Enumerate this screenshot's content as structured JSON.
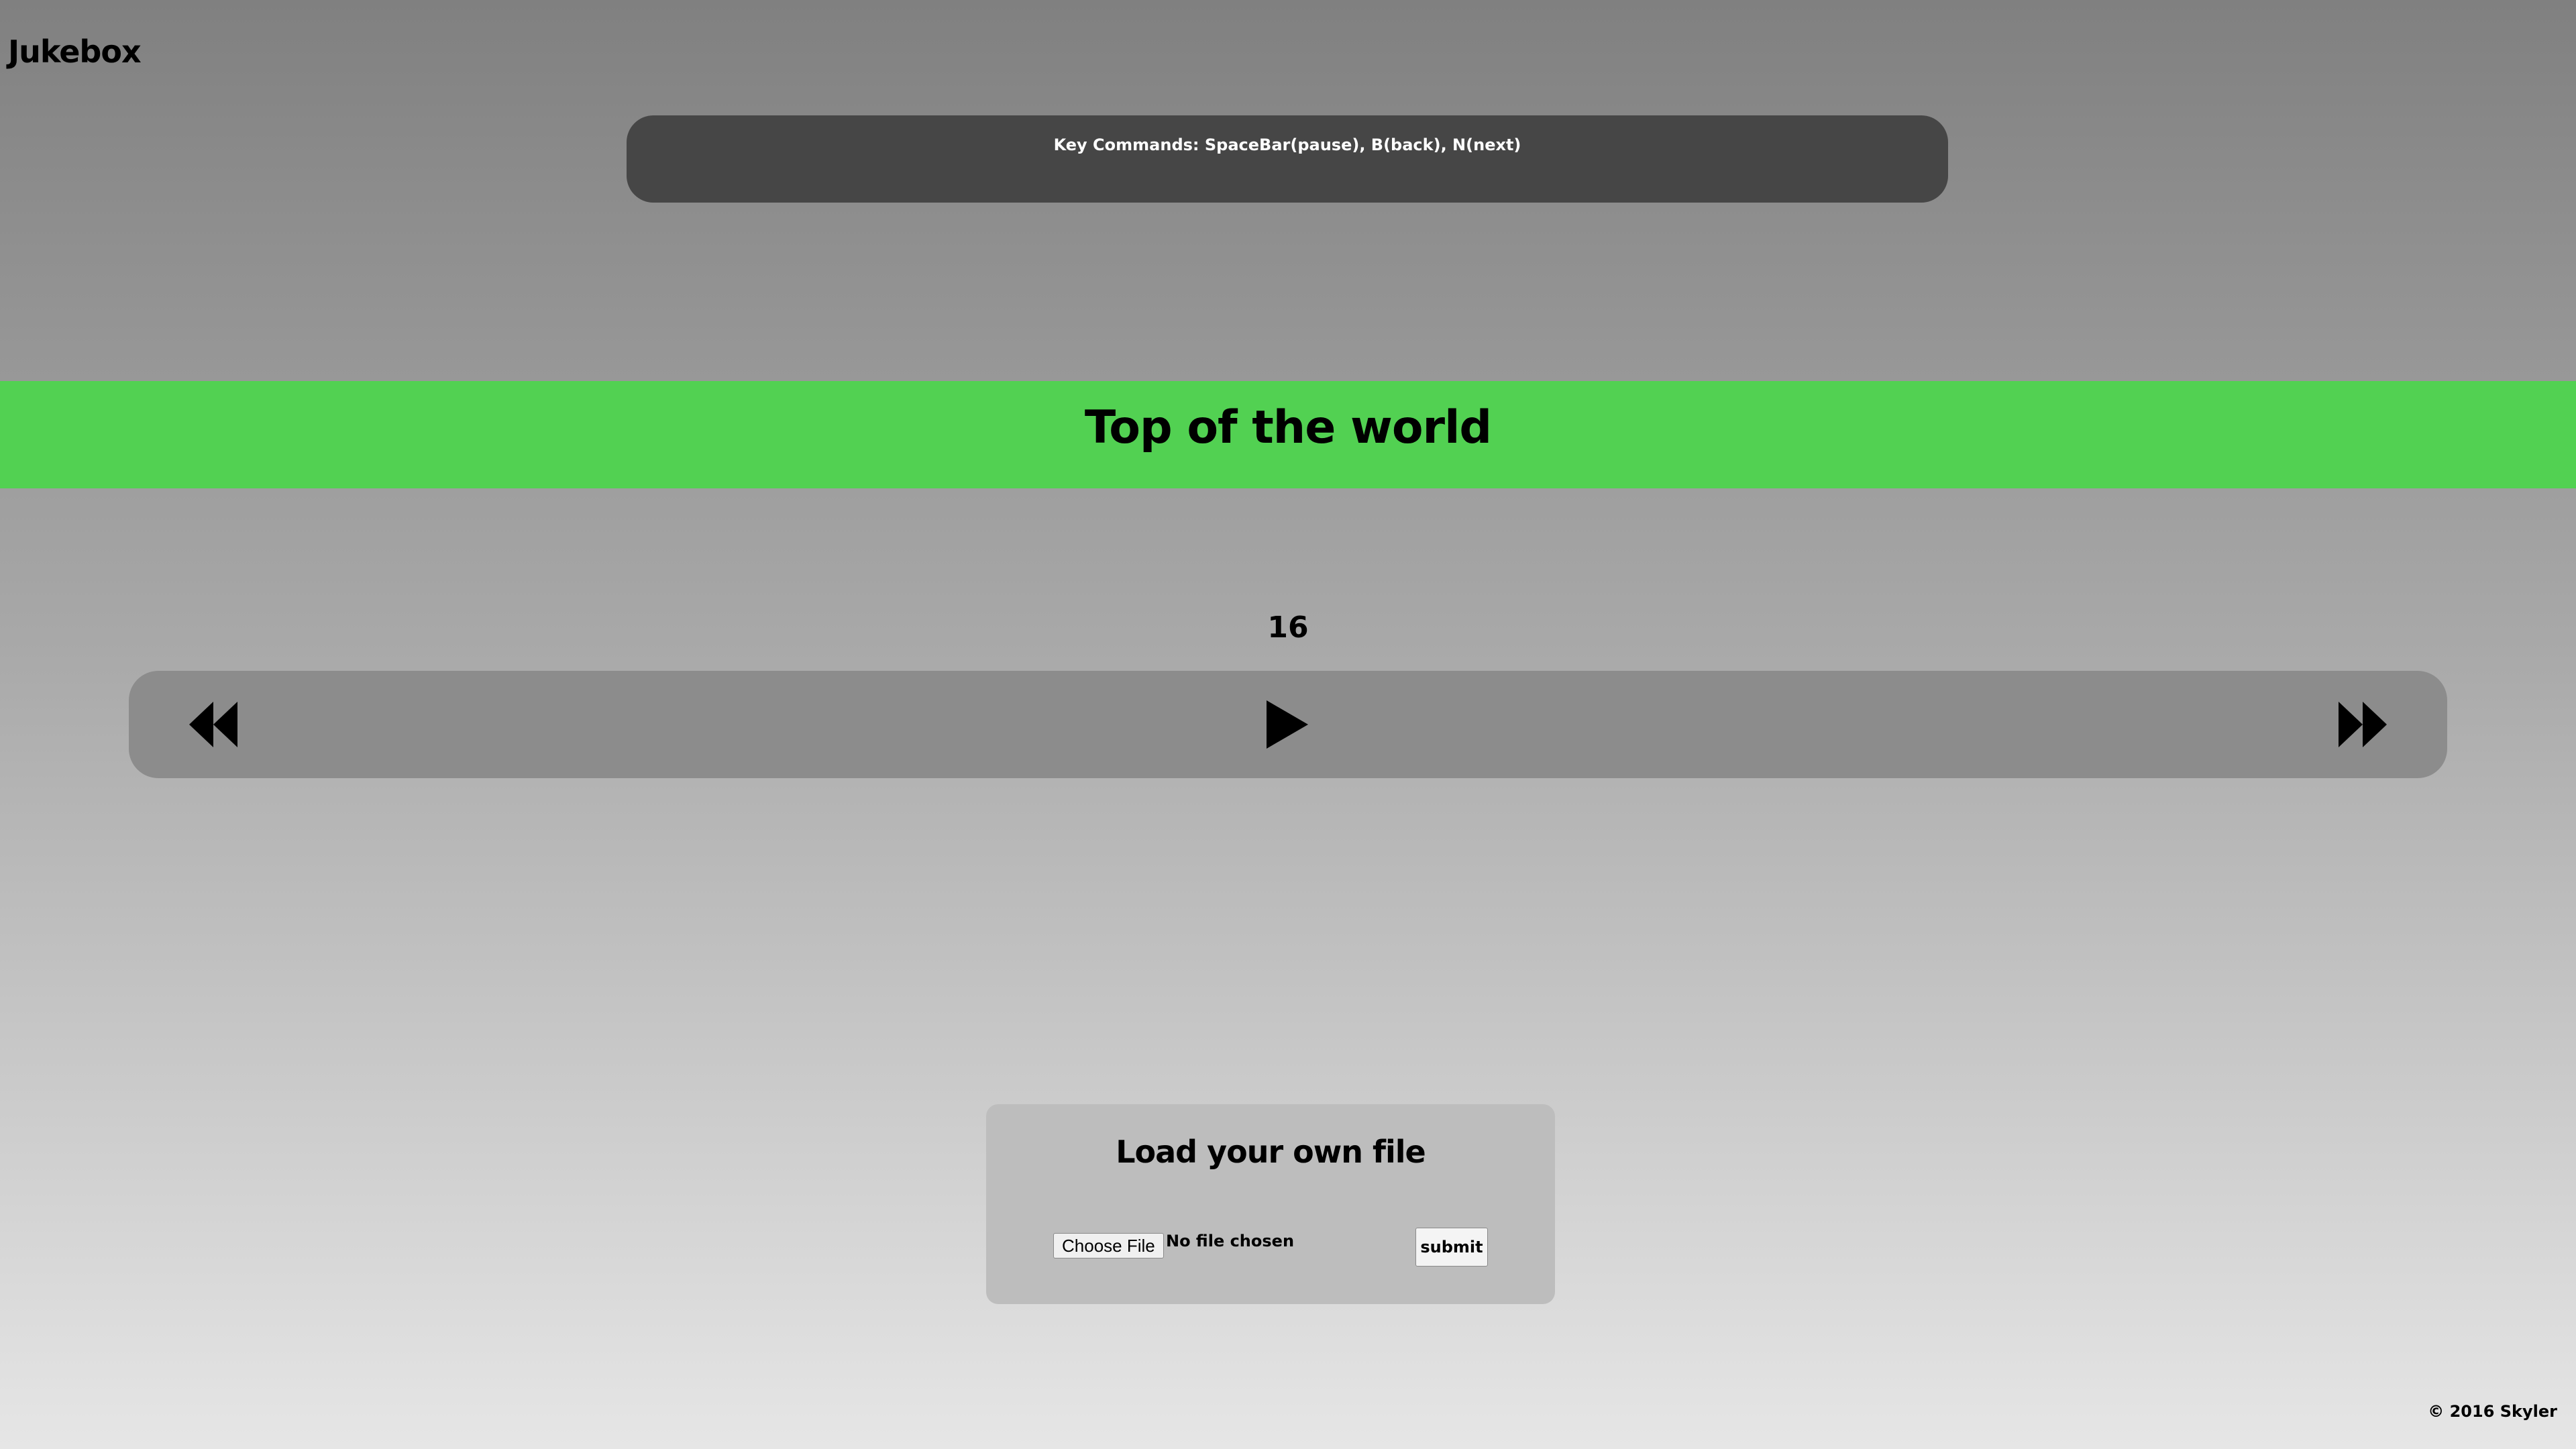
{
  "header": {
    "app_title": "Jukebox"
  },
  "key_commands": {
    "text": "Key Commands: SpaceBar(pause), B(back), N(next)"
  },
  "now_playing": {
    "song_title": "Top of the world",
    "track_number": "16"
  },
  "controls": {
    "back_icon": "rewind-icon",
    "play_icon": "play-icon",
    "next_icon": "fast-forward-icon"
  },
  "upload": {
    "title": "Load your own file",
    "choose_file_label": "Choose File",
    "file_status": "No file chosen",
    "submit_label": "submit"
  },
  "footer": {
    "copyright": "© 2016 Skyler"
  },
  "colors": {
    "banner": "#52d152",
    "key_commands_bg": "#464646",
    "controls_bg": "#8c8c8c",
    "upload_bg": "#bdbdbd"
  }
}
